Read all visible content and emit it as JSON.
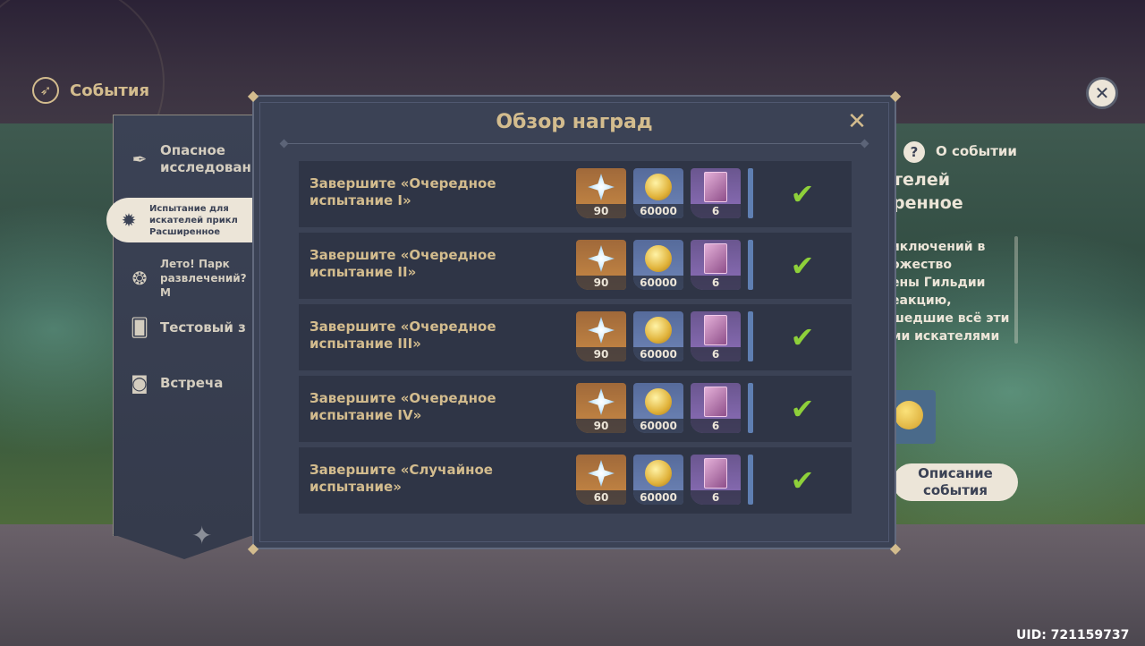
{
  "header": {
    "title": "События"
  },
  "sidebar": {
    "items": [
      {
        "label": "Опасное исследован",
        "icon": "feather-icon"
      },
      {
        "label": "Испытание для искателей прикл Расширенное",
        "icon": "flame-icon"
      },
      {
        "label": "Лето! Парк развлечений? М",
        "icon": "fire-swirl-icon"
      },
      {
        "label": "Тестовый з",
        "icon": "cards-icon"
      },
      {
        "label": "Встреча",
        "icon": "book-eye-icon"
      }
    ]
  },
  "right_panel": {
    "about_label": "О событии",
    "title": "телей\nренное",
    "description": "иключений в\nожество\nены Гильдии\nеакцию,\nшедшие всё эти\nми искателями",
    "description_button": "Описание события"
  },
  "modal": {
    "title": "Обзор наград",
    "rows": [
      {
        "task": "Завершите «Очередное\nиспытание I»",
        "primogems": "90",
        "mora": "60000",
        "books": "6",
        "completed": true
      },
      {
        "task": "Завершите «Очередное\nиспытание II»",
        "primogems": "90",
        "mora": "60000",
        "books": "6",
        "completed": true
      },
      {
        "task": "Завершите «Очередное\nиспытание III»",
        "primogems": "90",
        "mora": "60000",
        "books": "6",
        "completed": true
      },
      {
        "task": "Завершите «Очередное\nиспытание IV»",
        "primogems": "90",
        "mora": "60000",
        "books": "6",
        "completed": true
      },
      {
        "task": "Завершите «Случайное\nиспытание»",
        "primogems": "60",
        "mora": "60000",
        "books": "6",
        "completed": true
      }
    ]
  },
  "uid": "UID: 721159737",
  "colors": {
    "gold": "#d3bc8e",
    "panel": "#3b4255",
    "check": "#8ed03a",
    "cream": "#ece5d8"
  }
}
